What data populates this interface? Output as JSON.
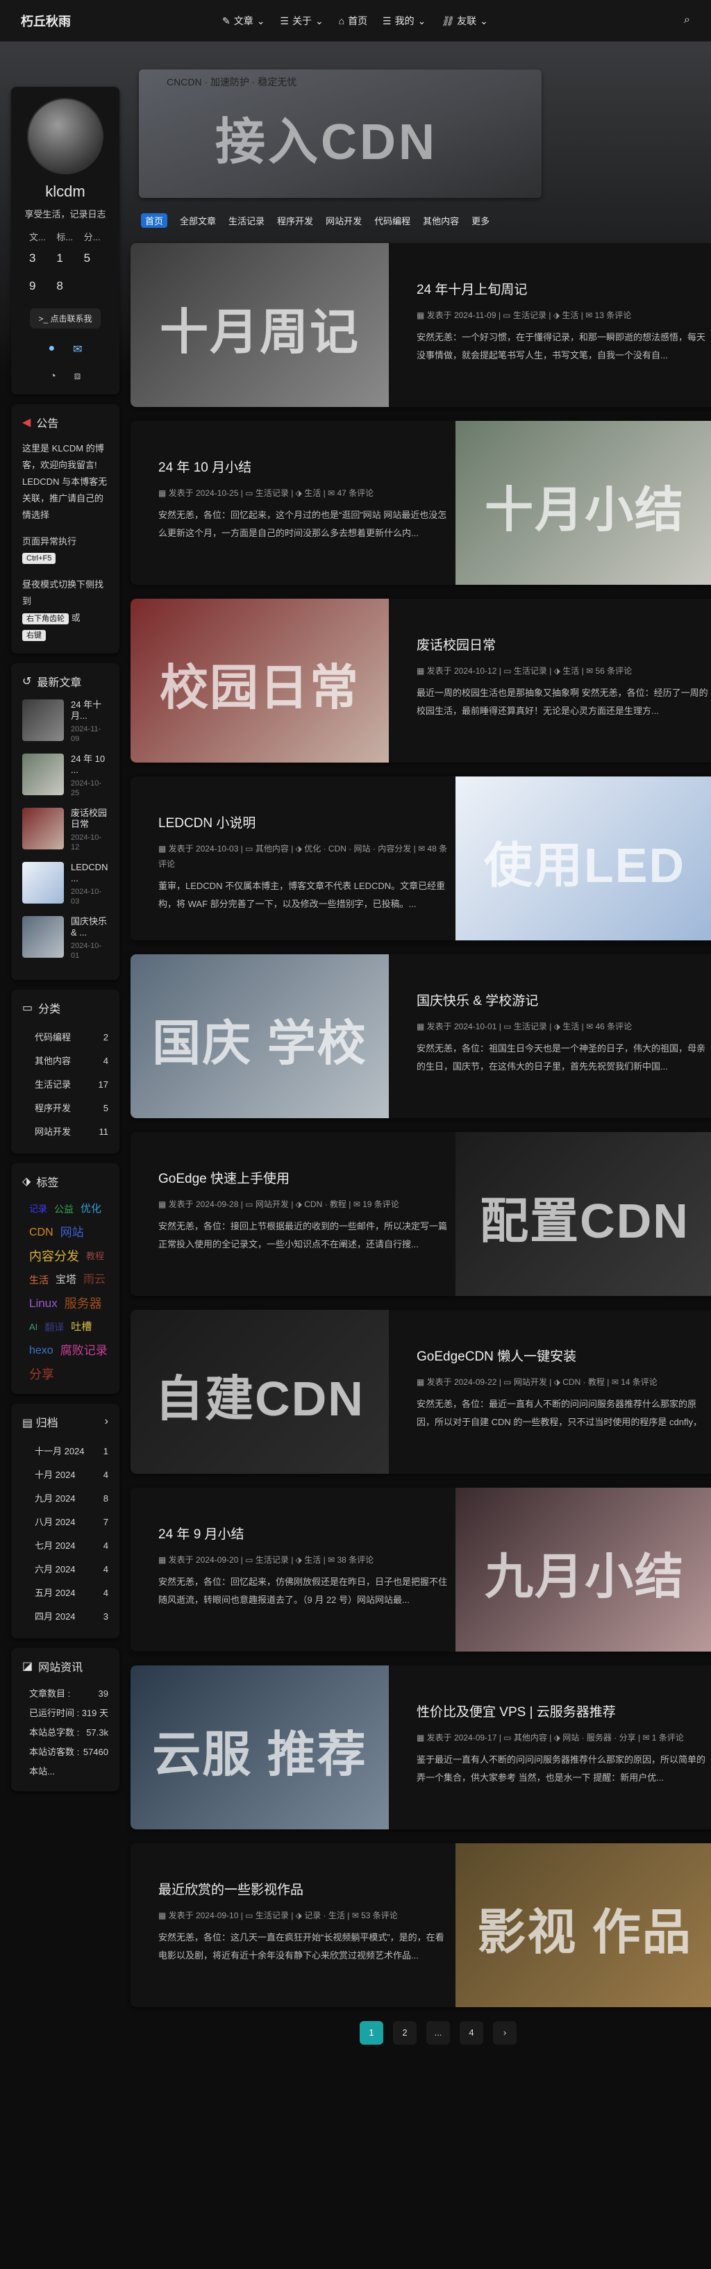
{
  "nav": {
    "brand": "朽丘秋雨",
    "menu": [
      {
        "label": "文章",
        "icon": "pen-icon"
      },
      {
        "label": "关于",
        "icon": "list-icon"
      },
      {
        "label": "首页",
        "icon": "home-icon"
      },
      {
        "label": "我的",
        "icon": "list-icon"
      },
      {
        "label": "友联",
        "icon": "link-icon"
      }
    ],
    "search_icon": "⌕"
  },
  "profile": {
    "name": "klcdm",
    "desc": "享受生活，记录日志",
    "stat_labels": [
      "文...",
      "标...",
      "分..."
    ],
    "stat_values": [
      "3",
      "1",
      "5",
      "9",
      "8"
    ],
    "follow": "点击联系我"
  },
  "notice": {
    "title": "公告",
    "p1": "这里是 KLCDM 的博客，欢迎向我留言! LEDCDN 与本博客无关联，推广请自己的情选择",
    "p2": "页面异常执行",
    "k1": "Ctrl+F5",
    "p3": "昼夜模式切换下侧找到",
    "k2": "右下角齿轮",
    "or": "或",
    "k3": "右键"
  },
  "recent": {
    "title": "最新文章",
    "items": [
      {
        "title": "24 年十月...",
        "date": "2024-11-09"
      },
      {
        "title": "24 年 10 ...",
        "date": "2024-10-25"
      },
      {
        "title": "废话校园日常",
        "date": "2024-10-12"
      },
      {
        "title": "LEDCDN ...",
        "date": "2024-10-03"
      },
      {
        "title": "国庆快乐 & ...",
        "date": "2024-10-01"
      }
    ]
  },
  "categories": {
    "title": "分类",
    "items": [
      {
        "name": "代码编程",
        "count": "2"
      },
      {
        "name": "其他内容",
        "count": "4"
      },
      {
        "name": "生活记录",
        "count": "17"
      },
      {
        "name": "程序开发",
        "count": "5"
      },
      {
        "name": "网站开发",
        "count": "11"
      }
    ]
  },
  "tags": {
    "title": "标签",
    "items": [
      {
        "name": "记录",
        "color": "#3b3bff"
      },
      {
        "name": "公益",
        "color": "#2fa84f"
      },
      {
        "name": "优化",
        "color": "#2e9fd0"
      },
      {
        "name": "CDN",
        "color": "#d08b28"
      },
      {
        "name": "网站",
        "color": "#3b62d8"
      },
      {
        "name": "内容分发",
        "color": "#d7b23c"
      },
      {
        "name": "教程",
        "color": "#9a4747"
      },
      {
        "name": "生活",
        "color": "#e06c3c"
      },
      {
        "name": "宝塔",
        "color": "#c9c9c9"
      },
      {
        "name": "雨云",
        "color": "#7b3b2a"
      },
      {
        "name": "Linux",
        "color": "#9b59d0"
      },
      {
        "name": "服务器",
        "color": "#a14d1e"
      },
      {
        "name": "AI",
        "color": "#39a070"
      },
      {
        "name": "翻译",
        "color": "#3a3a8a"
      },
      {
        "name": "吐槽",
        "color": "#d8c04a"
      },
      {
        "name": "hexo",
        "color": "#3c73c9"
      },
      {
        "name": "腐败记录",
        "color": "#c9409a"
      },
      {
        "name": "分享",
        "color": "#a23a2b"
      }
    ]
  },
  "archives": {
    "title": "归档",
    "items": [
      {
        "name": "十一月 2024",
        "count": "1"
      },
      {
        "name": "十月 2024",
        "count": "4"
      },
      {
        "name": "九月 2024",
        "count": "8"
      },
      {
        "name": "八月 2024",
        "count": "7"
      },
      {
        "name": "七月 2024",
        "count": "4"
      },
      {
        "name": "六月 2024",
        "count": "4"
      },
      {
        "name": "五月 2024",
        "count": "4"
      },
      {
        "name": "四月 2024",
        "count": "3"
      }
    ]
  },
  "siteinfo": {
    "title": "网站资讯",
    "rows": [
      {
        "k": "文章数目 :",
        "v": "39"
      },
      {
        "k": "已运行时间 :",
        "v": "319 天"
      },
      {
        "k": "本站总字数 :",
        "v": "57.3k"
      },
      {
        "k": "本站访客数 :",
        "v": "57460"
      },
      {
        "k": "本站...",
        "v": ""
      }
    ]
  },
  "banner": {
    "title": "CNCDN · 加速防护 · 稳定无忧",
    "word": "接入CDN"
  },
  "tabs": [
    "首页",
    "全部文章",
    "生活记录",
    "程序开发",
    "网站开发",
    "代码编程",
    "其他内容",
    "更多"
  ],
  "posts": [
    {
      "title": "24 年十月上旬周记",
      "date": "发表于 2024-11-09",
      "cat": "生活记录",
      "tags": "生活",
      "comments": "13 条评论",
      "excerpt": "安然无恙：一个好习惯，在于懂得记录，和那一瞬即逝的想法感悟，每天没事情做，就会提起笔书写人生，书写文笔，自我一个没有自...",
      "word": "十月周记",
      "c1": "#3b3b3b",
      "c2": "#8a8a8a"
    },
    {
      "title": "24 年 10 月小结",
      "date": "发表于 2024-10-25",
      "cat": "生活记录",
      "tags": "生活",
      "comments": "47 条评论",
      "excerpt": "安然无恙，各位：回忆起来，这个月过的也是“逛回”网站 网站最近也没怎么更新这个月，一方面是自己的时间没那么多去想着更新什么内...",
      "word": "十月小结",
      "c1": "#6a7a6a",
      "c2": "#c9c9c2"
    },
    {
      "title": "废话校园日常",
      "date": "发表于 2024-10-12",
      "cat": "生活记录",
      "tags": "生活",
      "comments": "56 条评论",
      "excerpt": "最近一周的校园生活也是那抽象又抽象啊 安然无恙，各位：经历了一周的校园生活，最前睡得还算真好！无论是心灵方面还是生理方...",
      "word": "校园日常",
      "c1": "#7a2a2a",
      "c2": "#c7b1a6"
    },
    {
      "title": "LEDCDN 小说明",
      "date": "发表于 2024-10-03",
      "cat": "其他内容",
      "tags": "优化 · CDN · 网站 · 内容分发",
      "comments": "48 条评论",
      "excerpt": "董审，LEDCDN 不仅属本博主，博客文章不代表 LEDCDN。文章已经重构，将 WAF 部分完善了一下，以及修改一些措别字，已投稿。...",
      "word": "使用LED",
      "c1": "#eef2f8",
      "c2": "#9fb8d8"
    },
    {
      "title": "国庆快乐 & 学校游记",
      "date": "发表于 2024-10-01",
      "cat": "生活记录",
      "tags": "生活",
      "comments": "46 条评论",
      "excerpt": "安然无恙，各位：祖国生日今天也是一个神圣的日子，伟大的祖国，母亲的生日，国庆节，在这伟大的日子里，首先先祝贺我们新中国...",
      "word": "国庆 学校",
      "c1": "#5a6a7a",
      "c2": "#b8c0c6"
    },
    {
      "title": "GoEdge 快速上手使用",
      "date": "发表于 2024-09-28",
      "cat": "网站开发",
      "tags": "CDN · 教程",
      "comments": "19 条评论",
      "excerpt": "安然无恙，各位：接回上节根据最近的收到的一些邮件，所以决定写一篇正常投入使用的全记录文，一些小知识点不在阐述，还请自行搜...",
      "word": "配置CDN",
      "c1": "#1c1c1c",
      "c2": "#3a3a3a"
    },
    {
      "title": "GoEdgeCDN 懒人一键安装",
      "date": "发表于 2024-09-22",
      "cat": "网站开发",
      "tags": "CDN · 教程",
      "comments": "14 条评论",
      "excerpt": "安然无恙，各位：最近一直有人不断的问问问服务器推荐什么那家的原因，所以对于自建 CDN 的一些教程，只不过当时使用的程序是 cdnfly，不过已...",
      "word": "自建CDN",
      "c1": "#1a1a1a",
      "c2": "#2e2e2e"
    },
    {
      "title": "24 年 9 月小结",
      "date": "发表于 2024-09-20",
      "cat": "生活记录",
      "tags": "生活",
      "comments": "38 条评论",
      "excerpt": "安然无恙，各位：回忆起来，仿佛刚放假还是在昨日，日子也是把握不住随风逝流，转眼间也意趣报道去了。（9 月 22 号）网站网站最...",
      "word": "九月小结",
      "c1": "#3a2a2e",
      "c2": "#b99a9a"
    },
    {
      "title": "性价比及便宜 VPS | 云服务器推荐",
      "date": "发表于 2024-09-17",
      "cat": "其他内容",
      "tags": "网站 · 服务器 · 分享",
      "comments": "1 条评论",
      "excerpt": "鉴于最近一直有人不断的问问问服务器推荐什么那家的原因，所以简单的弄一个集合，供大家参考 当然，也是水一下 提醒：新用户优...",
      "word": "云服 推荐",
      "c1": "#2a3a4a",
      "c2": "#7a8a9a"
    },
    {
      "title": "最近欣赏的一些影视作品",
      "date": "发表于 2024-09-10",
      "cat": "生活记录",
      "tags": "记录 · 生活",
      "comments": "53 条评论",
      "excerpt": "安然无恙，各位：这几天一直在疯狂开始“长视频躺平模式”，是的，在看电影以及剧，将近有近十余年没有静下心来欣赏过视频艺术作品...",
      "word": "影视 作品",
      "c1": "#5a4a2a",
      "c2": "#9a7a4a"
    }
  ],
  "pager": [
    "1",
    "2",
    "...",
    "4",
    "›"
  ]
}
